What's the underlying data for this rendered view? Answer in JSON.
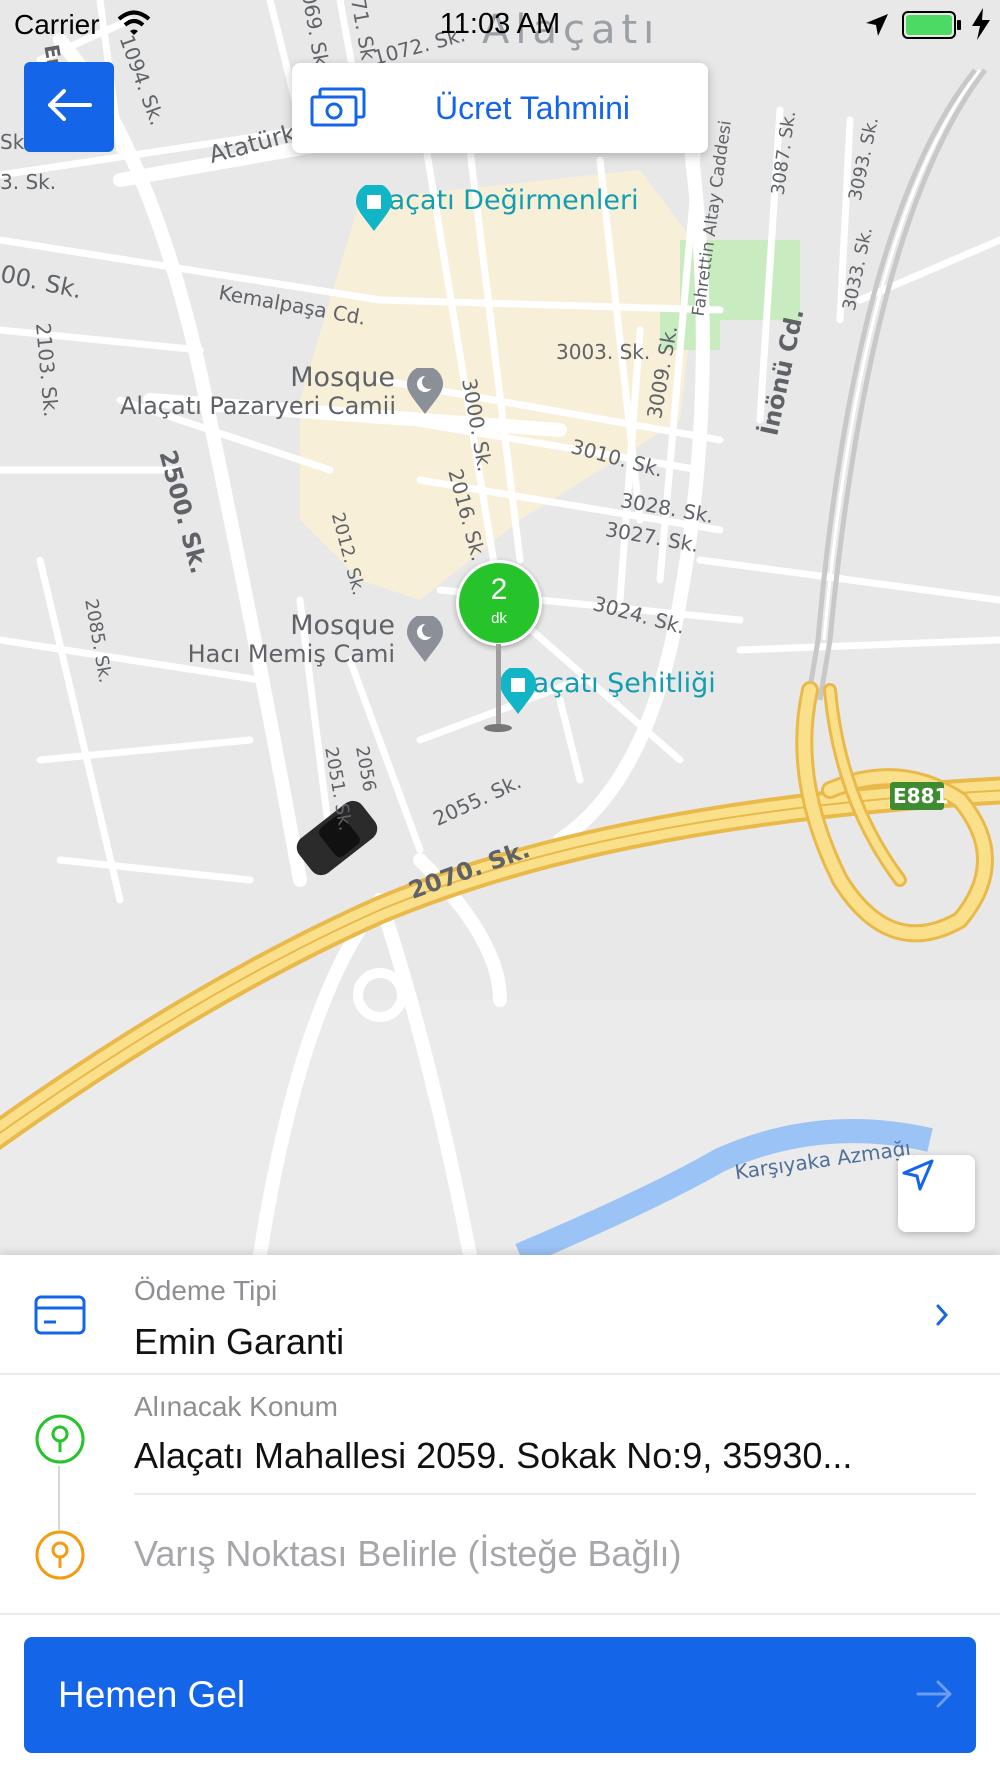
{
  "status_bar": {
    "carrier": "Carrier",
    "time": "11:03 AM"
  },
  "header": {
    "back_icon": "arrow-left-icon",
    "fare_estimate_label": "Ücret Tahmini",
    "fare_icon": "banknote-icon"
  },
  "map": {
    "area_label": "Alaçatı",
    "streets": [
      "Eran",
      "1094. Sk.",
      "069. Sk.",
      "071. Sk.",
      "1072. Sk.",
      "Atatürk",
      "3. Sk.",
      "00. Sk.",
      "Kemalpaşa Cd.",
      "2103. Sk.",
      "2500. Sk.",
      "3000. Sk.",
      "2016. Sk.",
      "2012. Sk.",
      "2085. Sk.",
      "3003. Sk.",
      "3009. Sk.",
      "3010. Sk.",
      "3028. Sk.",
      "3027. Sk.",
      "3024. Sk.",
      "Fahrettin Altay Caddesi",
      "3087. Sk.",
      "3093. Sk.",
      "3033. Sk.",
      "İnönü Cd.",
      "2051. Sk.",
      "2056",
      "2055. Sk.",
      "2070. Sk.",
      "Karşıyaka Azmağı",
      "Sk"
    ],
    "highway_badge": "E881",
    "pois": {
      "windmills": "Alaçatı Değirmenleri",
      "mosque1_type": "Mosque",
      "mosque1_name": "Alaçatı Pazaryeri Camii",
      "mosque2_type": "Mosque",
      "mosque2_name": "Hacı Memiş Cami",
      "martyrs": "Alaçatı Şehitliği"
    },
    "eta": {
      "value": "2",
      "unit": "dk"
    },
    "locate_icon": "navigation-arrow-icon"
  },
  "panel": {
    "payment": {
      "label": "Ödeme Tipi",
      "value": "Emin Garanti",
      "icon": "credit-card-icon"
    },
    "pickup": {
      "label": "Alınacak Konum",
      "value": "Alaçatı Mahallesi 2059. Sokak No:9, 35930...",
      "icon": "pin-icon",
      "color": "#27c32a"
    },
    "destination": {
      "placeholder": "Varış Noktası Belirle (İsteğe Bağlı)",
      "icon": "pin-icon",
      "color": "#f39c12"
    }
  },
  "cta": {
    "label": "Hemen Gel",
    "icon": "arrow-right-icon"
  },
  "colors": {
    "accent": "#1565e8",
    "eta_green": "#27c32a",
    "highway": "#f7d36a"
  }
}
